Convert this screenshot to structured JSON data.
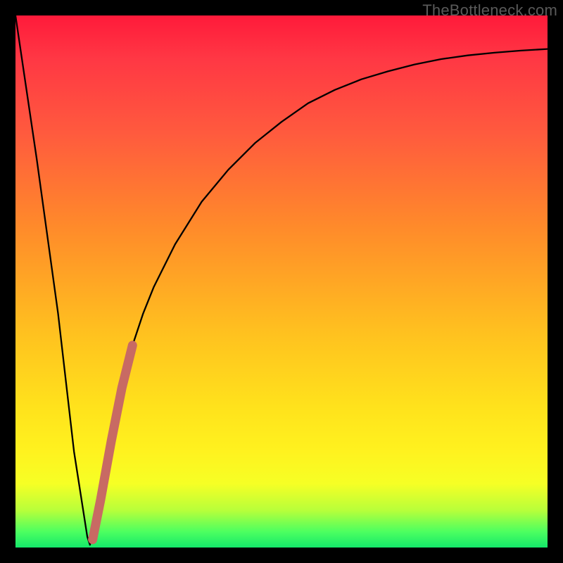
{
  "watermark": "TheBottleneck.com",
  "colors": {
    "curve_stroke": "#000000",
    "highlight_stroke": "#c86a63",
    "frame": "#000000"
  },
  "chart_data": {
    "type": "line",
    "title": "",
    "xlabel": "",
    "ylabel": "",
    "xlim": [
      0,
      100
    ],
    "ylim": [
      0,
      100
    ],
    "curve": {
      "x": [
        0,
        4,
        8,
        11,
        13.5,
        14,
        16,
        18,
        20,
        22,
        24,
        26,
        30,
        35,
        40,
        45,
        50,
        55,
        60,
        65,
        70,
        75,
        80,
        85,
        90,
        95,
        100
      ],
      "y": [
        100,
        73,
        44,
        18,
        2,
        0.5,
        9,
        20,
        30,
        38,
        44,
        49,
        57,
        65,
        71,
        76,
        80,
        83.5,
        86,
        88,
        89.5,
        90.8,
        91.8,
        92.5,
        93,
        93.4,
        93.7
      ]
    },
    "highlight_segment": {
      "x": [
        14.5,
        16,
        18,
        20,
        22
      ],
      "y": [
        1.5,
        9,
        20,
        30,
        38
      ]
    }
  }
}
